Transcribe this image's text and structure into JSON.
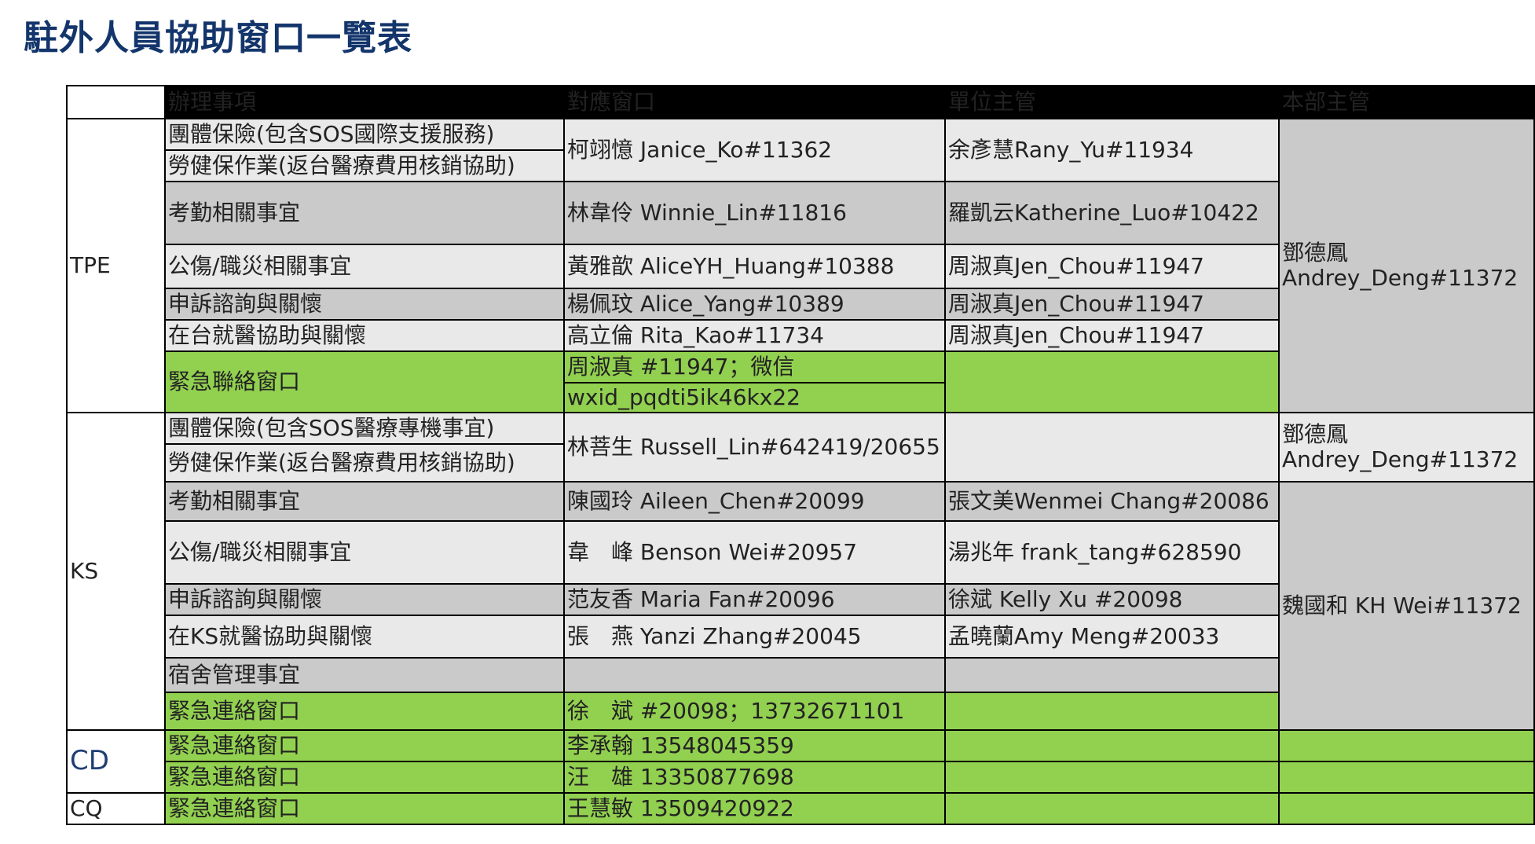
{
  "title": "駐外人員協助窗口一覽表",
  "headers": [
    "",
    "辦理事項",
    "對應窗口",
    "單位主管",
    "本部主管"
  ],
  "tpe": {
    "site": "TPE",
    "r1": {
      "item_a": "團體保險(包含SOS國際支援服務)",
      "item_b": "勞健保作業(返台醫療費用核銷協助)",
      "contact": "柯翊憶 Janice_Ko#11362",
      "unit_mgr": "余彥慧Rany_Yu#11934"
    },
    "r2": {
      "item": "考勤相關事宜",
      "contact": "林韋伶 Winnie_Lin#11816",
      "unit_mgr": "羅凱云Katherine_Luo#10422"
    },
    "r3": {
      "item": "公傷/職災相關事宜",
      "contact": "黃雅歆 AliceYH_Huang#10388",
      "unit_mgr": "周淑真Jen_Chou#11947"
    },
    "r4": {
      "item": "申訴諮詢與關懷",
      "contact": "楊佩玟 Alice_Yang#10389",
      "unit_mgr": "周淑真Jen_Chou#11947"
    },
    "r5": {
      "item": "在台就醫協助與關懷",
      "contact": "高立倫 Rita_Kao#11734",
      "unit_mgr": "周淑真Jen_Chou#11947"
    },
    "r6": {
      "item": "緊急聯絡窗口",
      "contact_l1": "周淑真 #11947；微信",
      "contact_l2": "wxid_pqdti5ik46kx22",
      "unit_mgr": ""
    },
    "dept_mgr_l1": "鄧德鳳",
    "dept_mgr_l2": "Andrey_Deng#11372"
  },
  "ks": {
    "site": "KS",
    "r1": {
      "item_a": "團體保險(包含SOS醫療專機事宜)",
      "item_b": "勞健保作業(返台醫療費用核銷協助)",
      "contact": "林菩生 Russell_Lin#642419/20655",
      "unit_mgr": ""
    },
    "dept_mgr1_l1": "鄧德鳳",
    "dept_mgr1_l2": "Andrey_Deng#11372",
    "r2": {
      "item": "考勤相關事宜",
      "contact": "陳國玲 Aileen_Chen#20099",
      "unit_mgr": "張文美Wenmei Chang#20086"
    },
    "r3": {
      "item": "公傷/職災相關事宜",
      "contact": "韋　峰 Benson Wei#20957",
      "unit_mgr": "湯兆年 frank_tang#628590"
    },
    "r4": {
      "item": "申訴諮詢與關懷",
      "contact": "范友香 Maria Fan#20096",
      "unit_mgr": "徐斌 Kelly Xu #20098"
    },
    "r5": {
      "item": "在KS就醫協助與關懷",
      "contact": "張　燕 Yanzi Zhang#20045",
      "unit_mgr": "孟曉蘭Amy Meng#20033"
    },
    "r6": {
      "item": "宿舍管理事宜",
      "contact": "",
      "unit_mgr": ""
    },
    "r7": {
      "item": "緊急連絡窗口",
      "contact": "徐　斌 #20098；13732671101",
      "unit_mgr": ""
    },
    "dept_mgr2": "魏國和 KH Wei#11372"
  },
  "cd": {
    "site": "CD",
    "r1": {
      "item": "緊急連絡窗口",
      "contact": "李承翰 13548045359"
    },
    "r2": {
      "item": "緊急連絡窗口",
      "contact": "汪　雄 13350877698"
    }
  },
  "cq": {
    "site": "CQ",
    "r1": {
      "item": "緊急連絡窗口",
      "contact": "王慧敏 13509420922"
    }
  }
}
